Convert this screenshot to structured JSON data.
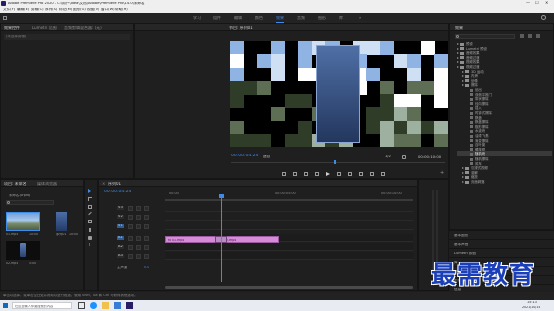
{
  "window": {
    "title": "Adobe Premiere Pro 2020 - C:\\用户\\Idea\\文档\\Adobe\\Premiere Pro\\14.0\\未命名",
    "controls": [
      "—",
      "☐",
      "✕"
    ]
  },
  "menu": [
    "文件(F)",
    "编辑(E)",
    "剪辑(C)",
    "序列(S)",
    "标记(M)",
    "图形(G)",
    "视图(V)",
    "窗口(W)",
    "帮助(H)"
  ],
  "workspaces": [
    {
      "label": "学习",
      "active": false
    },
    {
      "label": "组件",
      "active": false
    },
    {
      "label": "编辑",
      "active": false
    },
    {
      "label": "颜色",
      "active": false
    },
    {
      "label": "效果",
      "active": true
    },
    {
      "label": "音频",
      "active": false
    },
    {
      "label": "图形",
      "active": false
    },
    {
      "label": "库",
      "active": false
    },
    {
      "label": "»",
      "active": false
    }
  ],
  "source_panel": {
    "tabs": [
      "效果控件",
      "Lumetri 范围",
      "音频剪辑混合器: (无)"
    ],
    "empty_label": "(未选择剪辑)"
  },
  "program_monitor": {
    "tab": "节目: 序列01",
    "timecode": "00:00:04:24",
    "fit": "适合",
    "quality": "1/2",
    "duration": "00:00:10:00"
  },
  "project_panel": {
    "tabs": [
      "项目: 未命名",
      "媒体浏览器"
    ],
    "project_name": "未命名.prproj",
    "search_placeholder": "",
    "items": [
      {
        "name": "01.mp4",
        "duration": "10:00"
      },
      {
        "name": "序列01",
        "duration": "10:00"
      },
      {
        "name": "02.mp4",
        "duration": "5:00"
      }
    ]
  },
  "timeline": {
    "tab": "序列01",
    "timecode": "00:00:04:24",
    "ruler": [
      "00:00",
      "00:00:05:00",
      "00:00:10:00"
    ],
    "video_tracks": [
      "V3",
      "V2",
      "V1"
    ],
    "audio_tracks": [
      "A1",
      "A2",
      "A3"
    ],
    "master_label": "主声道",
    "master_value": "0.0",
    "clips": [
      {
        "label": "fx 01.mp4"
      },
      {
        "label": "fx 02.mp4"
      }
    ]
  },
  "effects_panel": {
    "tab": "效果",
    "search_placeholder": "",
    "tree": [
      {
        "label": "预设",
        "level": 0,
        "open": false
      },
      {
        "label": "Lumetri 预设",
        "level": 0,
        "open": false
      },
      {
        "label": "音频效果",
        "level": 0,
        "open": false
      },
      {
        "label": "音频过渡",
        "level": 0,
        "open": false
      },
      {
        "label": "视频效果",
        "level": 0,
        "open": false
      },
      {
        "label": "视频过渡",
        "level": 0,
        "open": true
      },
      {
        "label": "3D 运动",
        "level": 1,
        "open": false
      },
      {
        "label": "内滑",
        "level": 1,
        "open": false
      },
      {
        "label": "划像",
        "level": 1,
        "open": false
      },
      {
        "label": "擦除",
        "level": 1,
        "open": true
      },
      {
        "label": "划出",
        "level": 2
      },
      {
        "label": "双侧平推门",
        "level": 2
      },
      {
        "label": "带状擦除",
        "level": 2
      },
      {
        "label": "径向擦除",
        "level": 2
      },
      {
        "label": "插入",
        "level": 2
      },
      {
        "label": "时钟式擦除",
        "level": 2
      },
      {
        "label": "棋盘",
        "level": 2
      },
      {
        "label": "棋盘擦除",
        "level": 2
      },
      {
        "label": "楔形擦除",
        "level": 2
      },
      {
        "label": "水波块",
        "level": 2
      },
      {
        "label": "油漆飞溅",
        "level": 2
      },
      {
        "label": "渐变擦除",
        "level": 2
      },
      {
        "label": "百叶窗",
        "level": 2
      },
      {
        "label": "螺旋框",
        "level": 2
      },
      {
        "label": "随机块",
        "level": 2,
        "selected": true
      },
      {
        "label": "随机擦除",
        "level": 2
      },
      {
        "label": "风车",
        "level": 2
      },
      {
        "label": "沉浸式视频",
        "level": 1,
        "open": false
      },
      {
        "label": "溶解",
        "level": 1,
        "open": false
      },
      {
        "label": "缩放",
        "level": 1,
        "open": false
      },
      {
        "label": "页面剥落",
        "level": 1,
        "open": false
      }
    ],
    "bottom_sections": [
      "基本图形",
      "基本声音",
      "Lumetri 颜色",
      "库",
      "标记",
      "历史记录",
      "信息"
    ]
  },
  "status_bar": "单击以选择，或单击空白处并拖动以进行框选。使用 Shift、Alt 和 Ctrl 可获得其他选项。",
  "taskbar": {
    "time": "15:13",
    "date": "2021/10/15",
    "search": "在这里输入你要搜索的内容"
  },
  "watermark": "最需教育",
  "colors": {
    "accent": "#3d8ce8",
    "clip": "#d78ad8",
    "playhead": "#3d8ce8",
    "watermark": "#1a3fb8"
  }
}
